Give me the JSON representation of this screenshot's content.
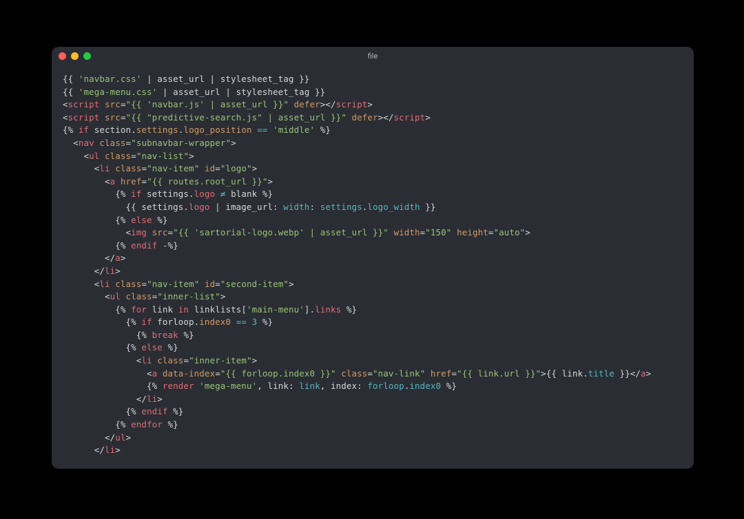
{
  "window": {
    "title": "file"
  },
  "code": {
    "lines": [
      [
        {
          "c": "pun",
          "t": "{{ "
        },
        {
          "c": "str",
          "t": "'navbar.css'"
        },
        {
          "c": "pun",
          "t": " | asset_url | stylesheet_tag }}"
        }
      ],
      [
        {
          "c": "pun",
          "t": "{{ "
        },
        {
          "c": "str",
          "t": "'mega-menu.css'"
        },
        {
          "c": "pun",
          "t": " | asset_url | stylesheet_tag }}"
        }
      ],
      [
        {
          "c": "pun",
          "t": "<"
        },
        {
          "c": "tag",
          "t": "script"
        },
        {
          "c": "pun",
          "t": " "
        },
        {
          "c": "attr",
          "t": "src"
        },
        {
          "c": "pun",
          "t": "="
        },
        {
          "c": "str",
          "t": "\"{{ 'navbar.js' | asset_url }}\""
        },
        {
          "c": "pun",
          "t": " "
        },
        {
          "c": "attr",
          "t": "defer"
        },
        {
          "c": "pun",
          "t": "></"
        },
        {
          "c": "tag",
          "t": "script"
        },
        {
          "c": "pun",
          "t": ">"
        }
      ],
      [
        {
          "c": "pun",
          "t": "<"
        },
        {
          "c": "tag",
          "t": "script"
        },
        {
          "c": "pun",
          "t": " "
        },
        {
          "c": "attr",
          "t": "src"
        },
        {
          "c": "pun",
          "t": "="
        },
        {
          "c": "str",
          "t": "\"{{ \"predictive-search.js\" | asset_url }}\""
        },
        {
          "c": "pun",
          "t": " "
        },
        {
          "c": "attr",
          "t": "defer"
        },
        {
          "c": "pun",
          "t": "></"
        },
        {
          "c": "tag",
          "t": "script"
        },
        {
          "c": "pun",
          "t": ">"
        }
      ],
      [
        {
          "c": "pun",
          "t": "{% "
        },
        {
          "c": "tag",
          "t": "if"
        },
        {
          "c": "pun",
          "t": " section."
        },
        {
          "c": "attr",
          "t": "settings"
        },
        {
          "c": "pun",
          "t": "."
        },
        {
          "c": "attr",
          "t": "logo_position"
        },
        {
          "c": "pun",
          "t": " "
        },
        {
          "c": "cy",
          "t": "=="
        },
        {
          "c": "pun",
          "t": " "
        },
        {
          "c": "str",
          "t": "'middle'"
        },
        {
          "c": "pun",
          "t": " %}"
        }
      ],
      [
        {
          "c": "pun",
          "t": "  <"
        },
        {
          "c": "tag",
          "t": "nav"
        },
        {
          "c": "pun",
          "t": " "
        },
        {
          "c": "attr",
          "t": "class"
        },
        {
          "c": "pun",
          "t": "="
        },
        {
          "c": "str",
          "t": "\"subnavbar-wrapper\""
        },
        {
          "c": "pun",
          "t": ">"
        }
      ],
      [
        {
          "c": "pun",
          "t": "    <"
        },
        {
          "c": "tag",
          "t": "ul"
        },
        {
          "c": "pun",
          "t": " "
        },
        {
          "c": "attr",
          "t": "class"
        },
        {
          "c": "pun",
          "t": "="
        },
        {
          "c": "str",
          "t": "\"nav-list\""
        },
        {
          "c": "pun",
          "t": ">"
        }
      ],
      [
        {
          "c": "pun",
          "t": "      <"
        },
        {
          "c": "tag",
          "t": "li"
        },
        {
          "c": "pun",
          "t": " "
        },
        {
          "c": "attr",
          "t": "class"
        },
        {
          "c": "pun",
          "t": "="
        },
        {
          "c": "str",
          "t": "\"nav-item\""
        },
        {
          "c": "pun",
          "t": " "
        },
        {
          "c": "attr",
          "t": "id"
        },
        {
          "c": "pun",
          "t": "="
        },
        {
          "c": "str",
          "t": "\"logo\""
        },
        {
          "c": "pun",
          "t": ">"
        }
      ],
      [
        {
          "c": "pun",
          "t": "        <"
        },
        {
          "c": "tag",
          "t": "a"
        },
        {
          "c": "pun",
          "t": " "
        },
        {
          "c": "attr",
          "t": "href"
        },
        {
          "c": "pun",
          "t": "="
        },
        {
          "c": "str",
          "t": "\"{{ routes.root_url }}\""
        },
        {
          "c": "pun",
          "t": ">"
        }
      ],
      [
        {
          "c": "pun",
          "t": "          {% "
        },
        {
          "c": "tag",
          "t": "if"
        },
        {
          "c": "pun",
          "t": " settings."
        },
        {
          "c": "prop",
          "t": "logo"
        },
        {
          "c": "pun",
          "t": " "
        },
        {
          "c": "cy",
          "t": "≠"
        },
        {
          "c": "pun",
          "t": " blank %}"
        }
      ],
      [
        {
          "c": "pun",
          "t": "            {{ settings."
        },
        {
          "c": "prop",
          "t": "logo"
        },
        {
          "c": "pun",
          "t": " | image_url: "
        },
        {
          "c": "cy",
          "t": "width"
        },
        {
          "c": "pun",
          "t": ": "
        },
        {
          "c": "cy",
          "t": "settings"
        },
        {
          "c": "pun",
          "t": "."
        },
        {
          "c": "cy",
          "t": "logo_width"
        },
        {
          "c": "pun",
          "t": " }}"
        }
      ],
      [
        {
          "c": "pun",
          "t": "          {% "
        },
        {
          "c": "tag",
          "t": "else"
        },
        {
          "c": "pun",
          "t": " %}"
        }
      ],
      [
        {
          "c": "pun",
          "t": "            <"
        },
        {
          "c": "tag",
          "t": "img"
        },
        {
          "c": "pun",
          "t": " "
        },
        {
          "c": "attr",
          "t": "src"
        },
        {
          "c": "pun",
          "t": "="
        },
        {
          "c": "str",
          "t": "\"{{ 'sartorial-logo.webp' | asset_url }}\""
        },
        {
          "c": "pun",
          "t": " "
        },
        {
          "c": "attr",
          "t": "width"
        },
        {
          "c": "pun",
          "t": "="
        },
        {
          "c": "str",
          "t": "\"150\""
        },
        {
          "c": "pun",
          "t": " "
        },
        {
          "c": "attr",
          "t": "height"
        },
        {
          "c": "pun",
          "t": "="
        },
        {
          "c": "str",
          "t": "\"auto\""
        },
        {
          "c": "pun",
          "t": ">"
        }
      ],
      [
        {
          "c": "pun",
          "t": "          {% "
        },
        {
          "c": "tag",
          "t": "endif"
        },
        {
          "c": "pun",
          "t": " -%}"
        }
      ],
      [
        {
          "c": "pun",
          "t": "        </"
        },
        {
          "c": "tag",
          "t": "a"
        },
        {
          "c": "pun",
          "t": ">"
        }
      ],
      [
        {
          "c": "pun",
          "t": "      </"
        },
        {
          "c": "tag",
          "t": "li"
        },
        {
          "c": "pun",
          "t": ">"
        }
      ],
      [
        {
          "c": "pun",
          "t": "      <"
        },
        {
          "c": "tag",
          "t": "li"
        },
        {
          "c": "pun",
          "t": " "
        },
        {
          "c": "attr",
          "t": "class"
        },
        {
          "c": "pun",
          "t": "="
        },
        {
          "c": "str",
          "t": "\"nav-item\""
        },
        {
          "c": "pun",
          "t": " "
        },
        {
          "c": "attr",
          "t": "id"
        },
        {
          "c": "pun",
          "t": "="
        },
        {
          "c": "str",
          "t": "\"second-item\""
        },
        {
          "c": "pun",
          "t": ">"
        }
      ],
      [
        {
          "c": "pun",
          "t": "        <"
        },
        {
          "c": "tag",
          "t": "ul"
        },
        {
          "c": "pun",
          "t": " "
        },
        {
          "c": "attr",
          "t": "class"
        },
        {
          "c": "pun",
          "t": "="
        },
        {
          "c": "str",
          "t": "\"inner-list\""
        },
        {
          "c": "pun",
          "t": ">"
        }
      ],
      [
        {
          "c": "pun",
          "t": "          {% "
        },
        {
          "c": "tag",
          "t": "for"
        },
        {
          "c": "pun",
          "t": " link "
        },
        {
          "c": "tag",
          "t": "in"
        },
        {
          "c": "pun",
          "t": " linklists["
        },
        {
          "c": "str",
          "t": "'main-menu'"
        },
        {
          "c": "pun",
          "t": "]."
        },
        {
          "c": "prop",
          "t": "links"
        },
        {
          "c": "pun",
          "t": " %}"
        }
      ],
      [
        {
          "c": "pun",
          "t": "            {% "
        },
        {
          "c": "tag",
          "t": "if"
        },
        {
          "c": "pun",
          "t": " forloop."
        },
        {
          "c": "attr",
          "t": "index0"
        },
        {
          "c": "pun",
          "t": " "
        },
        {
          "c": "cy",
          "t": "=="
        },
        {
          "c": "pun",
          "t": " "
        },
        {
          "c": "num",
          "t": "3"
        },
        {
          "c": "pun",
          "t": " %}"
        }
      ],
      [
        {
          "c": "pun",
          "t": "              {% "
        },
        {
          "c": "tag",
          "t": "break"
        },
        {
          "c": "pun",
          "t": " %}"
        }
      ],
      [
        {
          "c": "pun",
          "t": "            {% "
        },
        {
          "c": "tag",
          "t": "else"
        },
        {
          "c": "pun",
          "t": " %}"
        }
      ],
      [
        {
          "c": "pun",
          "t": "              <"
        },
        {
          "c": "tag",
          "t": "li"
        },
        {
          "c": "pun",
          "t": " "
        },
        {
          "c": "attr",
          "t": "class"
        },
        {
          "c": "pun",
          "t": "="
        },
        {
          "c": "str",
          "t": "\"inner-item\""
        },
        {
          "c": "pun",
          "t": ">"
        }
      ],
      [
        {
          "c": "pun",
          "t": "                <"
        },
        {
          "c": "tag",
          "t": "a"
        },
        {
          "c": "pun",
          "t": " "
        },
        {
          "c": "attr",
          "t": "data-index"
        },
        {
          "c": "pun",
          "t": "="
        },
        {
          "c": "str",
          "t": "\"{{ forloop.index0 }}\""
        },
        {
          "c": "pun",
          "t": " "
        },
        {
          "c": "attr",
          "t": "class"
        },
        {
          "c": "pun",
          "t": "="
        },
        {
          "c": "str",
          "t": "\"nav-link\""
        },
        {
          "c": "pun",
          "t": " "
        },
        {
          "c": "attr",
          "t": "href"
        },
        {
          "c": "pun",
          "t": "="
        },
        {
          "c": "str",
          "t": "\"{{ link.url }}\""
        },
        {
          "c": "pun",
          "t": ">{{ link."
        },
        {
          "c": "cy",
          "t": "title"
        },
        {
          "c": "pun",
          "t": " }}</"
        },
        {
          "c": "tag",
          "t": "a"
        },
        {
          "c": "pun",
          "t": ">"
        }
      ],
      [
        {
          "c": "pun",
          "t": "                {% "
        },
        {
          "c": "tag",
          "t": "render"
        },
        {
          "c": "pun",
          "t": " "
        },
        {
          "c": "str",
          "t": "'mega-menu'"
        },
        {
          "c": "pun",
          "t": ", link: "
        },
        {
          "c": "cy",
          "t": "link"
        },
        {
          "c": "pun",
          "t": ", index: "
        },
        {
          "c": "cy",
          "t": "forloop"
        },
        {
          "c": "pun",
          "t": "."
        },
        {
          "c": "cy",
          "t": "index0"
        },
        {
          "c": "pun",
          "t": " %}"
        }
      ],
      [
        {
          "c": "pun",
          "t": "              </"
        },
        {
          "c": "tag",
          "t": "li"
        },
        {
          "c": "pun",
          "t": ">"
        }
      ],
      [
        {
          "c": "pun",
          "t": "            {% "
        },
        {
          "c": "tag",
          "t": "endif"
        },
        {
          "c": "pun",
          "t": " %}"
        }
      ],
      [
        {
          "c": "pun",
          "t": "          {% "
        },
        {
          "c": "tag",
          "t": "endfor"
        },
        {
          "c": "pun",
          "t": " %}"
        }
      ],
      [
        {
          "c": "pun",
          "t": "        </"
        },
        {
          "c": "tag",
          "t": "ul"
        },
        {
          "c": "pun",
          "t": ">"
        }
      ],
      [
        {
          "c": "pun",
          "t": "      </"
        },
        {
          "c": "tag",
          "t": "li"
        },
        {
          "c": "pun",
          "t": ">"
        }
      ]
    ]
  }
}
